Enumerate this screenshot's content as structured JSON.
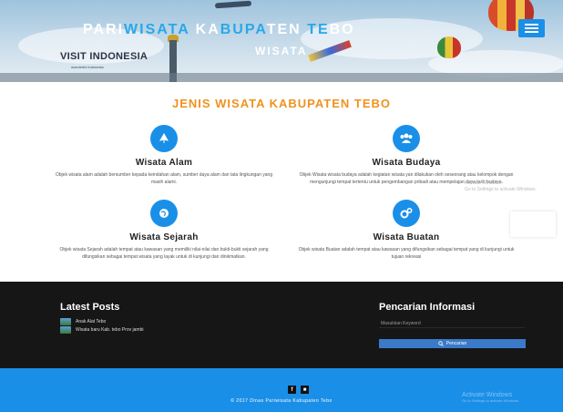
{
  "header": {
    "brand_parts": [
      "PARI",
      "WISATA",
      " KA",
      "BUPA",
      "TEN ",
      "TE",
      "BO"
    ],
    "subtitle": "WISATA",
    "logo_text": "VISIT INDONESIA",
    "logo_tagline": "wonderful indonesia",
    "brand_colors": {
      "white": "#ffffff",
      "highlight": "#29a8e8"
    }
  },
  "main": {
    "section_title": "JENIS WISATA KABUPATEN TEBO",
    "accent_color": "#f0921e",
    "features": [
      {
        "title": "Wisata Alam",
        "icon": "leaf-icon",
        "text": "Objek wisata alam adalah bersumber kepada keindahan alam, sumber daya alam dan tata lingkungan yang masih alami."
      },
      {
        "title": "Wisata Budaya",
        "icon": "users-icon",
        "text": "Objek Wisata wisata budaya adalah kegiatan wisata yan dilakukan oleh seseorang atau kelompok dengan mengunjungi tempat tertentu untuk pengembangan pribadi atau mempelajari daya tarik budaya."
      },
      {
        "title": "Wisata Sejarah",
        "icon": "globe-icon",
        "text": "Objek wisata Sejarah adalah tempat atau kawasan yang memiliki nilai-nilai dan bukti-bukti sejarah yang difungsikan sebagai tempat wisata yang layak untuk di kunjungi dan dinikmatkan."
      },
      {
        "title": "Wisata Buatan",
        "icon": "gears-icon",
        "text": "Objek wisata Buatan adalah tempat atau kawasan yang difungsikan sebagai tempat yang di kunjungi untuk tujuan rekreasi"
      }
    ],
    "watermark_lines": [
      "Activate Windows",
      "Go to Settings to activate Windows."
    ]
  },
  "footer": {
    "latest_posts_title": "Latest Posts",
    "posts": [
      "Anak Alat Tebo",
      "Wisata baru Kab. tebo Prov jambi"
    ],
    "search_title": "Pencarian Informasi",
    "search_placeholder": "Masukkan Keyword",
    "search_button": "Pencarian",
    "social": [
      "f",
      "■"
    ],
    "copyright": "© 2017 Dinas Pariwisata Kabupaten Tebo",
    "windows_watermark": [
      "Activate Windows",
      "Go to Settings to activate Windows."
    ],
    "colors": {
      "dark": "#161616",
      "blue": "#1a8fe8",
      "button": "#3a7ac8"
    }
  }
}
